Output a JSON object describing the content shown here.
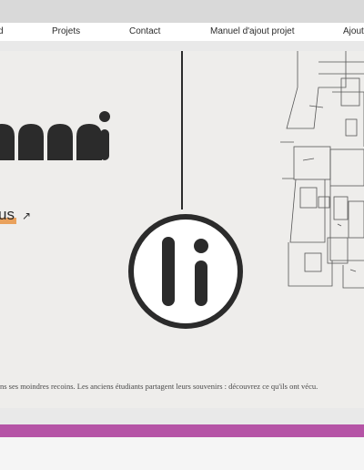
{
  "nav": {
    "items": [
      "d",
      "Projets",
      "Contact",
      "Manuel d'ajout projet",
      "Ajout"
    ]
  },
  "hero": {
    "about_link": "us",
    "arrow": "↗",
    "caption": "ns ses moindres recoins. Les anciens étudiants partagent leurs souvenirs : découvrez ce qu'ils ont vécu."
  },
  "colors": {
    "accent_orange": "#e9a15c",
    "accent_purple": "#b554a6",
    "ink": "#2b2b2b"
  },
  "icons": {
    "logo_badge": "li-monogram-badge",
    "arrow": "arrow-up-right-icon",
    "floorplan": "floor-plan-drawing"
  }
}
